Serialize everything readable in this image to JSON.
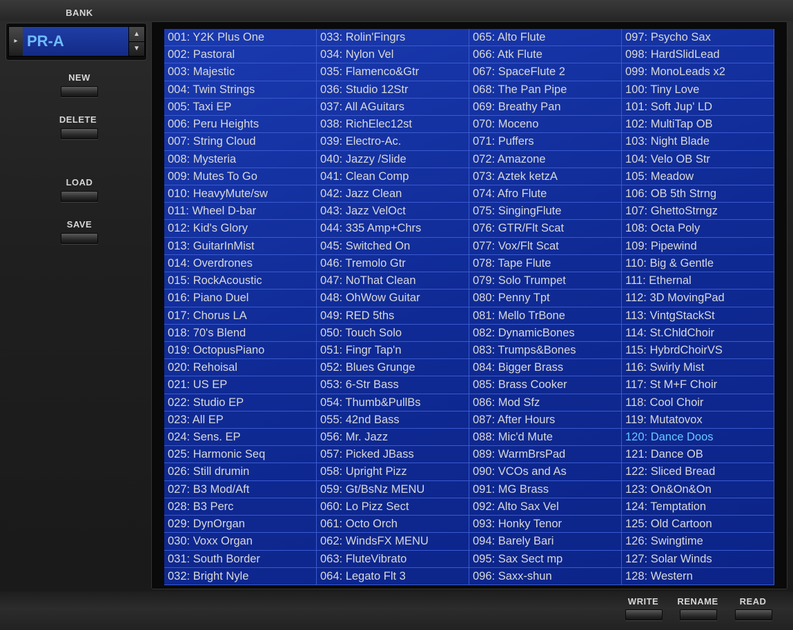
{
  "sidebar": {
    "bank_label": "BANK",
    "bank_value": "PR-A",
    "new_label": "NEW",
    "delete_label": "DELETE",
    "load_label": "LOAD",
    "save_label": "SAVE"
  },
  "footer": {
    "write_label": "WRITE",
    "rename_label": "RENAME",
    "read_label": "READ"
  },
  "selected_index": 119,
  "patches": [
    "001: Y2K Plus One",
    "002: Pastoral",
    "003: Majestic",
    "004: Twin Strings",
    "005: Taxi EP",
    "006: Peru Heights",
    "007: String Cloud",
    "008: Mysteria",
    "009: Mutes To Go",
    "010: HeavyMute/sw",
    "011: Wheel D-bar",
    "012: Kid's Glory",
    "013: GuitarInMist",
    "014: Overdrones",
    "015: RockAcoustic",
    "016: Piano Duel",
    "017: Chorus LA",
    "018: 70's Blend",
    "019: OctopusPiano",
    "020: Rehoisal",
    "021: US EP",
    "022: Studio EP",
    "023: All EP",
    "024: Sens. EP",
    "025: Harmonic Seq",
    "026: Still drumin",
    "027: B3 Mod/Aft",
    "028: B3 Perc",
    "029: DynOrgan",
    "030: Voxx Organ",
    "031: South Border",
    "032: Bright Nyle",
    "033: Rolin'Fingrs",
    "034: Nylon Vel",
    "035: Flamenco&Gtr",
    "036: Studio 12Str",
    "037: All AGuitars",
    "038: RichElec12st",
    "039: Electro-Ac.",
    "040: Jazzy /Slide",
    "041: Clean Comp",
    "042: Jazz Clean",
    "043: Jazz VelOct",
    "044: 335 Amp+Chrs",
    "045: Switched On",
    "046: Tremolo Gtr",
    "047: NoThat Clean",
    "048: OhWow Guitar",
    "049: RED 5ths",
    "050: Touch Solo",
    "051: Fingr Tap'n",
    "052: Blues Grunge",
    "053: 6-Str Bass",
    "054: Thumb&PullBs",
    "055: 42nd Bass",
    "056: Mr. Jazz",
    "057: Picked JBass",
    "058: Upright Pizz",
    "059: Gt/BsNz MENU",
    "060: Lo Pizz Sect",
    "061: Octo Orch",
    "062: WindsFX MENU",
    "063: FluteVibrato",
    "064: Legato Flt 3",
    "065: Alto Flute",
    "066: Atk Flute",
    "067: SpaceFlute 2",
    "068: The Pan Pipe",
    "069: Breathy Pan",
    "070: Moceno",
    "071: Puffers",
    "072: Amazone",
    "073: Aztek ketzA",
    "074: Afro Flute",
    "075: SingingFlute",
    "076: GTR/Flt Scat",
    "077: Vox/Flt Scat",
    "078: Tape Flute",
    "079: Solo Trumpet",
    "080: Penny Tpt",
    "081: Mello TrBone",
    "082: DynamicBones",
    "083: Trumps&Bones",
    "084: Bigger Brass",
    "085: Brass Cooker",
    "086: Mod Sfz",
    "087: After Hours",
    "088: Mic'd Mute",
    "089: WarmBrsPad",
    "090: VCOs and As",
    "091: MG Brass",
    "092: Alto Sax Vel",
    "093: Honky Tenor",
    "094: Barely Bari",
    "095: Sax Sect mp",
    "096: Saxx-shun",
    "097: Psycho Sax",
    "098: HardSlidLead",
    "099: MonoLeads x2",
    "100: Tiny Love",
    "101: Soft Jup' LD",
    "102: MultiTap OB",
    "103: Night Blade",
    "104: Velo OB Str",
    "105: Meadow",
    "106: OB 5th Strng",
    "107: GhettoStrngz",
    "108: Octa Poly",
    "109: Pipewind",
    "110: Big & Gentle",
    "111: Ethernal",
    "112: 3D MovingPad",
    "113: VintgStackSt",
    "114: St.ChldChoir",
    "115: HybrdChoirVS",
    "116: Swirly Mist",
    "117: St M+F Choir",
    "118: Cool Choir",
    "119: Mutatovox",
    "120: Dance Doos",
    "121: Dance OB",
    "122: Sliced Bread",
    "123: On&On&On",
    "124: Temptation",
    "125: Old Cartoon",
    "126: Swingtime",
    "127: Solar Winds",
    "128: Western"
  ]
}
